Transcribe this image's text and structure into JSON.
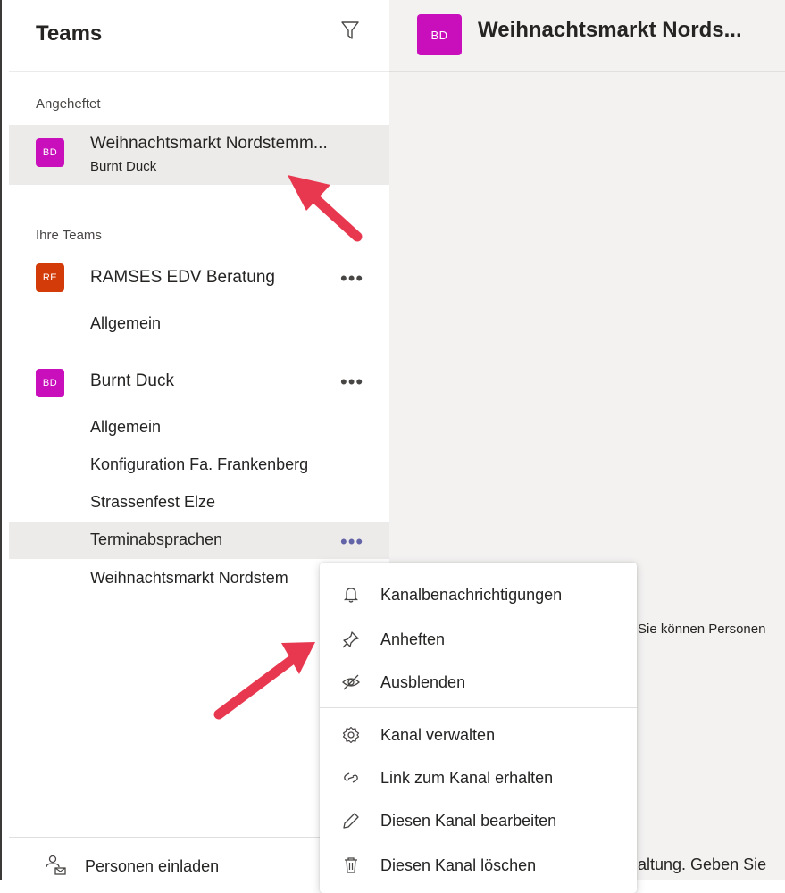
{
  "sidebar": {
    "title": "Teams",
    "pinned_label": "Angeheftet",
    "pinned_item": {
      "avatar": "BD",
      "avatar_color": "#c80fbb",
      "title": "Weihnachtsmarkt Nordstemm...",
      "subtitle": "Burnt Duck"
    },
    "your_teams_label": "Ihre Teams",
    "teams": [
      {
        "avatar": "RE",
        "avatar_color": "#d33c09",
        "name": "RAMSES EDV Beratung",
        "more": "•••",
        "channels": [
          "Allgemein"
        ]
      },
      {
        "avatar": "BD",
        "avatar_color": "#c80fbb",
        "name": "Burnt Duck",
        "more": "•••",
        "channels": [
          "Allgemein",
          "Konfiguration Fa. Frankenberg",
          "Strassenfest Elze",
          "Terminabsprachen",
          "Weihnachtsmarkt Nordstem"
        ]
      }
    ],
    "active_channel_more": "•••",
    "footer": {
      "invite_label": "Personen einladen"
    }
  },
  "main": {
    "header": {
      "avatar": "BD",
      "avatar_color": "#c80fbb",
      "title": "Weihnachtsmarkt Nords..."
    },
    "partial_text_1": "Sie können Personen",
    "partial_text_2": "altung. Geben Sie"
  },
  "context_menu": {
    "items": [
      {
        "label": "Kanalbenachrichtigungen",
        "icon": "bell-icon"
      },
      {
        "label": "Anheften",
        "icon": "pin-icon"
      },
      {
        "label": "Ausblenden",
        "icon": "hide-icon"
      },
      {
        "label": "Kanal verwalten",
        "icon": "gear-icon"
      },
      {
        "label": "Link zum Kanal erhalten",
        "icon": "link-icon"
      },
      {
        "label": "Diesen Kanal bearbeiten",
        "icon": "pencil-icon"
      },
      {
        "label": "Diesen Kanal löschen",
        "icon": "trash-icon"
      }
    ]
  },
  "colors": {
    "arrow": "#e8384f",
    "dots_active": "#6264a7"
  }
}
